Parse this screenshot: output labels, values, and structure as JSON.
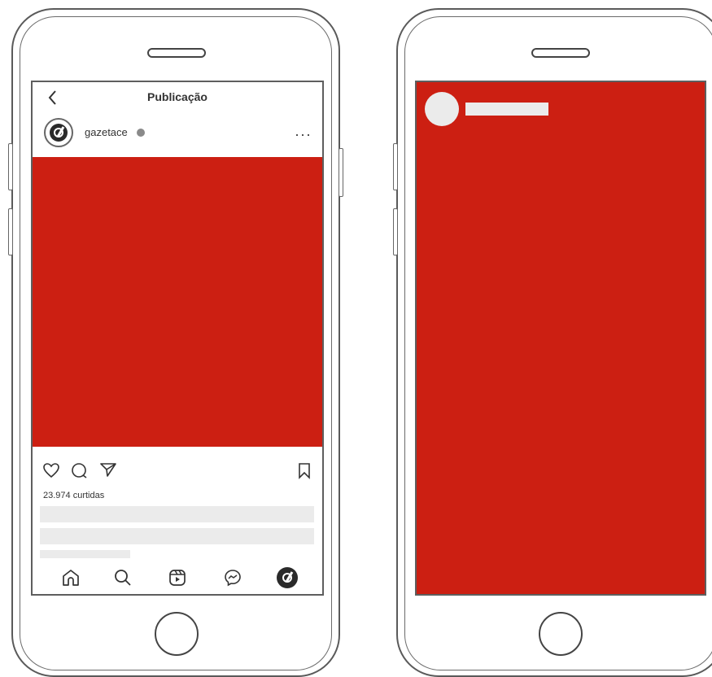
{
  "colors": {
    "media_red": "#cc1f12",
    "placeholder_gray": "#ebebeb",
    "outline": "#555555"
  },
  "left_phone": {
    "header": {
      "title": "Publicação",
      "back_icon": "chevron-left-icon"
    },
    "post": {
      "username": "gazetace",
      "verified_icon": "verified-badge-icon",
      "more_icon": "more-dots-icon",
      "more_label": "···",
      "action_icons": [
        "heart-icon",
        "comment-icon",
        "send-icon",
        "bookmark-icon"
      ],
      "likes": "23.974 curtidas"
    },
    "bottom_nav": {
      "items": [
        "home-icon",
        "search-icon",
        "reels-icon",
        "messenger-icon",
        "profile-icon"
      ]
    }
  },
  "right_phone": {
    "story": {
      "avatar_icon": "avatar-placeholder-icon",
      "username_placeholder_icon": "text-placeholder-icon"
    }
  }
}
